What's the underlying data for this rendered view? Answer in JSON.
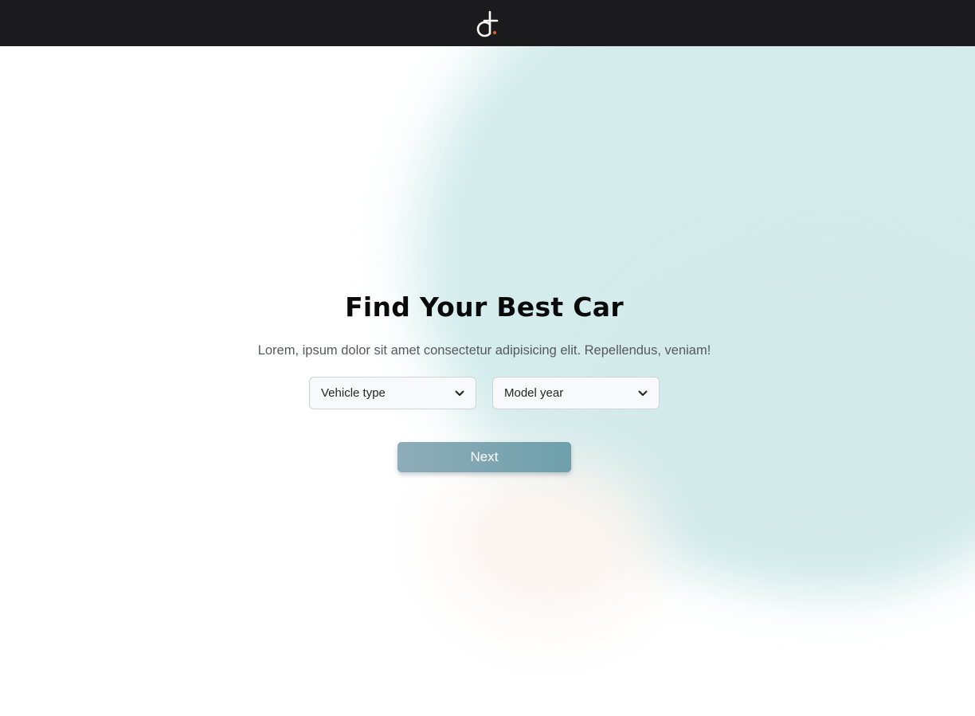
{
  "header": {
    "logo_icon": "d-dot-logo-icon",
    "accent_color": "#e4572e"
  },
  "hero": {
    "title": "Find Your Best Car",
    "subtitle": "Lorem, ipsum dolor sit amet consectetur adipisicing elit. Repellendus, veniam!"
  },
  "filters": {
    "vehicle_type": {
      "selected": "Vehicle type",
      "icon": "chevron-down-icon"
    },
    "model_year": {
      "selected": "Model year",
      "icon": "chevron-down-icon"
    }
  },
  "actions": {
    "next_label": "Next"
  },
  "colors": {
    "topbar": "#1b1b1d",
    "blob": "#d4ecec",
    "button_start": "#8eadb8",
    "button_end": "#6e9fac"
  }
}
